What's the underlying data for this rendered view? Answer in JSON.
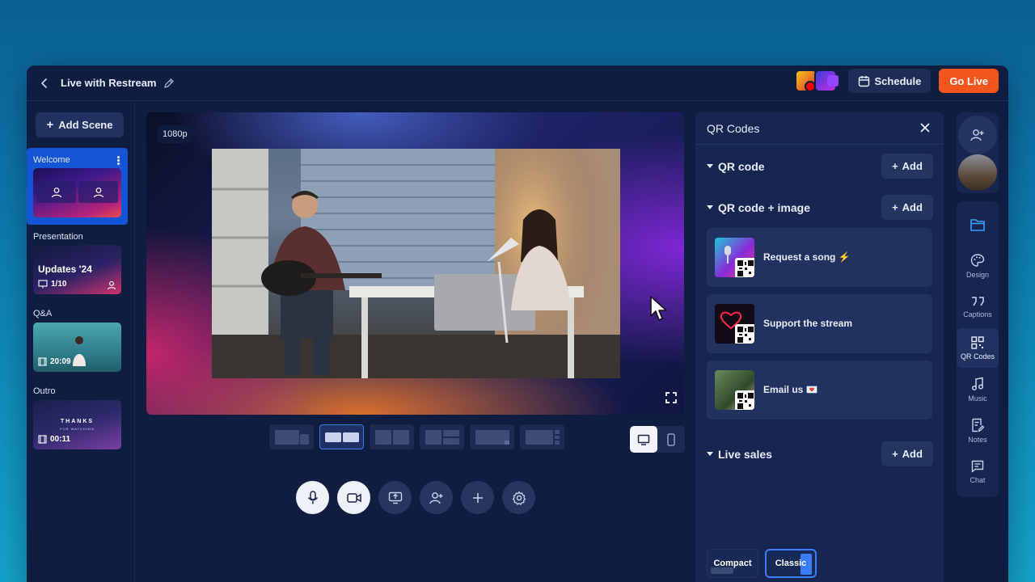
{
  "header": {
    "title": "Live with Restream",
    "schedule_label": "Schedule",
    "golive_label": "Go Live"
  },
  "scenes": {
    "add_label": "Add Scene",
    "items": [
      {
        "label": "Welcome"
      },
      {
        "label": "Presentation",
        "thumb_title": "Updates '24",
        "slides": "1/10"
      },
      {
        "label": "Q&A",
        "duration": "20:09"
      },
      {
        "label": "Outro",
        "thumb_title": "THANKS",
        "thumb_sub": "FOR WATCHING",
        "duration": "00:11"
      }
    ]
  },
  "stage": {
    "resolution": "1080p"
  },
  "panel": {
    "title": "QR Codes",
    "sections": {
      "qr_code": "QR code",
      "qr_image": "QR code + image",
      "live_sales": "Live sales"
    },
    "add_label": "Add",
    "cards": [
      {
        "label": "Request a song ⚡"
      },
      {
        "label": "Support the stream"
      },
      {
        "label": "Email us 💌"
      }
    ],
    "sales_options": [
      "Compact",
      "Classic"
    ],
    "sales_selected": "Classic"
  },
  "rail": {
    "items": [
      "Design",
      "Captions",
      "QR Codes",
      "Music",
      "Notes",
      "Chat"
    ],
    "active": "QR Codes"
  },
  "colors": {
    "accent": "#3b7bff",
    "golive": "#f2561d",
    "window_bg": "#0e1d40"
  }
}
